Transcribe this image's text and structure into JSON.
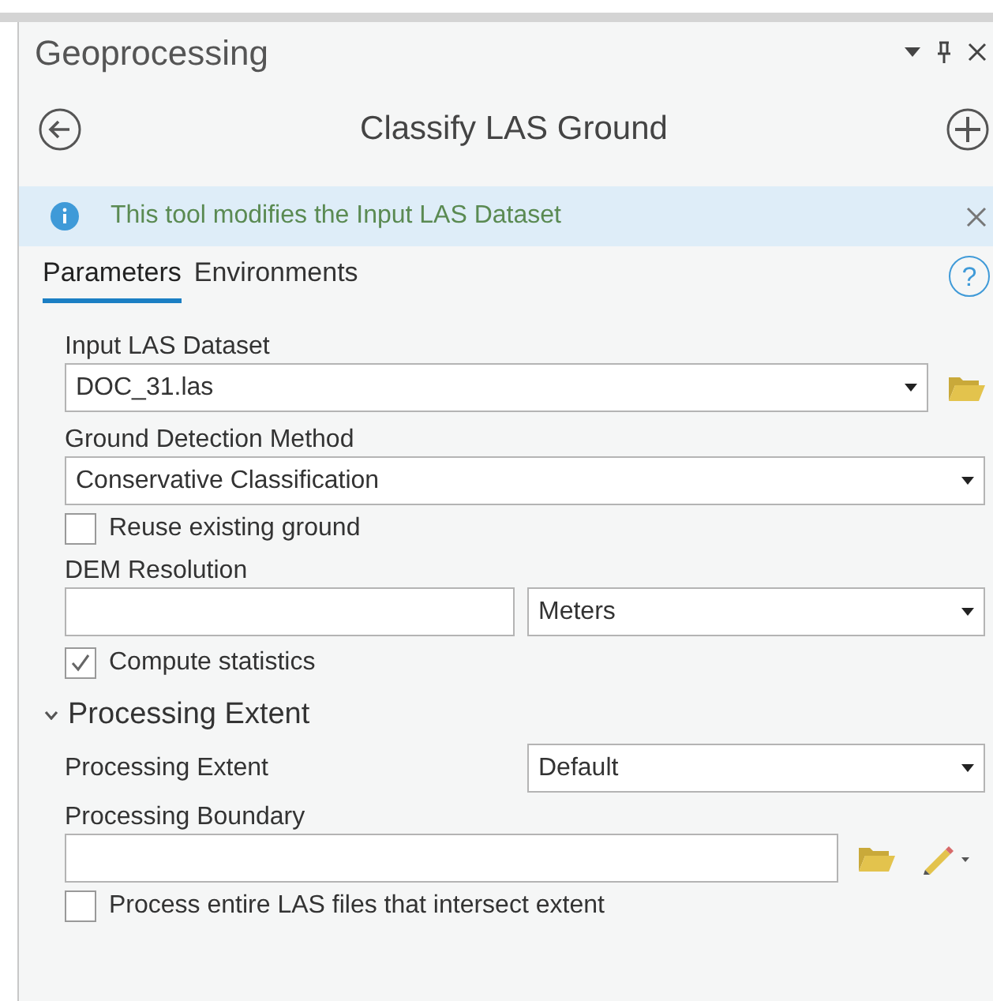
{
  "pane": {
    "title": "Geoprocessing"
  },
  "tool": {
    "title": "Classify LAS Ground"
  },
  "info": {
    "message": "This tool modifies the Input LAS Dataset"
  },
  "help": {
    "glyph": "?"
  },
  "tabs": [
    {
      "label": "Parameters",
      "selected": true
    },
    {
      "label": "Environments",
      "selected": false
    }
  ],
  "parameters": [
    {
      "kind": "file",
      "label": "Input LAS Dataset",
      "value": "DOC_31.las"
    },
    {
      "kind": "dropdown",
      "label": "Ground Detection Method",
      "value": "Conservative Classification"
    },
    {
      "kind": "checkbox",
      "label": "Reuse existing ground",
      "checked": false
    },
    {
      "kind": "unit",
      "label": "DEM Resolution",
      "unit": "Meters"
    },
    {
      "kind": "checkbox",
      "label": "Compute statistics",
      "checked": true
    },
    {
      "kind": "section",
      "label": "Processing Extent",
      "expanded": true,
      "children": [
        {
          "kind": "inline_dropdown",
          "label": "Processing Extent",
          "value": "Default"
        },
        {
          "kind": "feature",
          "label": "Processing Boundary"
        },
        {
          "kind": "checkbox",
          "label": "Process entire LAS files that intersect extent",
          "checked": false
        }
      ]
    }
  ]
}
